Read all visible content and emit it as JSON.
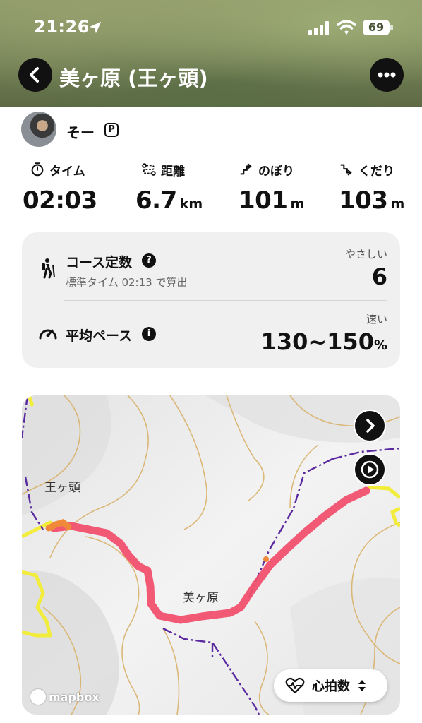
{
  "status_bar": {
    "time": "21:26",
    "battery": "69"
  },
  "header": {
    "title": "美ヶ原 (王ヶ頭)"
  },
  "user": {
    "name": "そー",
    "badge": "P"
  },
  "stats": [
    {
      "label": "タイム",
      "icon": "stopwatch-icon",
      "value": "02:03",
      "unit": ""
    },
    {
      "label": "距離",
      "icon": "route-icon",
      "value": "6.7",
      "unit": "km"
    },
    {
      "label": "のぼり",
      "icon": "ascent-icon",
      "value": "101",
      "unit": "m"
    },
    {
      "label": "くだり",
      "icon": "descent-icon",
      "value": "103",
      "unit": "m"
    }
  ],
  "course": {
    "title": "コース定数",
    "subtitle": "標準タイム 02:13 で算出",
    "meta": "やさしい",
    "value": "6"
  },
  "pace": {
    "title": "平均ペース",
    "meta": "速い",
    "value": "130~150",
    "unit": "%"
  },
  "map": {
    "labels": {
      "peak": "王ヶ頭",
      "plateau": "美ヶ原"
    },
    "attribution": "mapbox",
    "metric_selector": "心拍数",
    "colors": {
      "route": "#f0506e",
      "contour": "#d9b26a",
      "trail": "#5b2aa0",
      "road": "#f2ec3a"
    }
  }
}
